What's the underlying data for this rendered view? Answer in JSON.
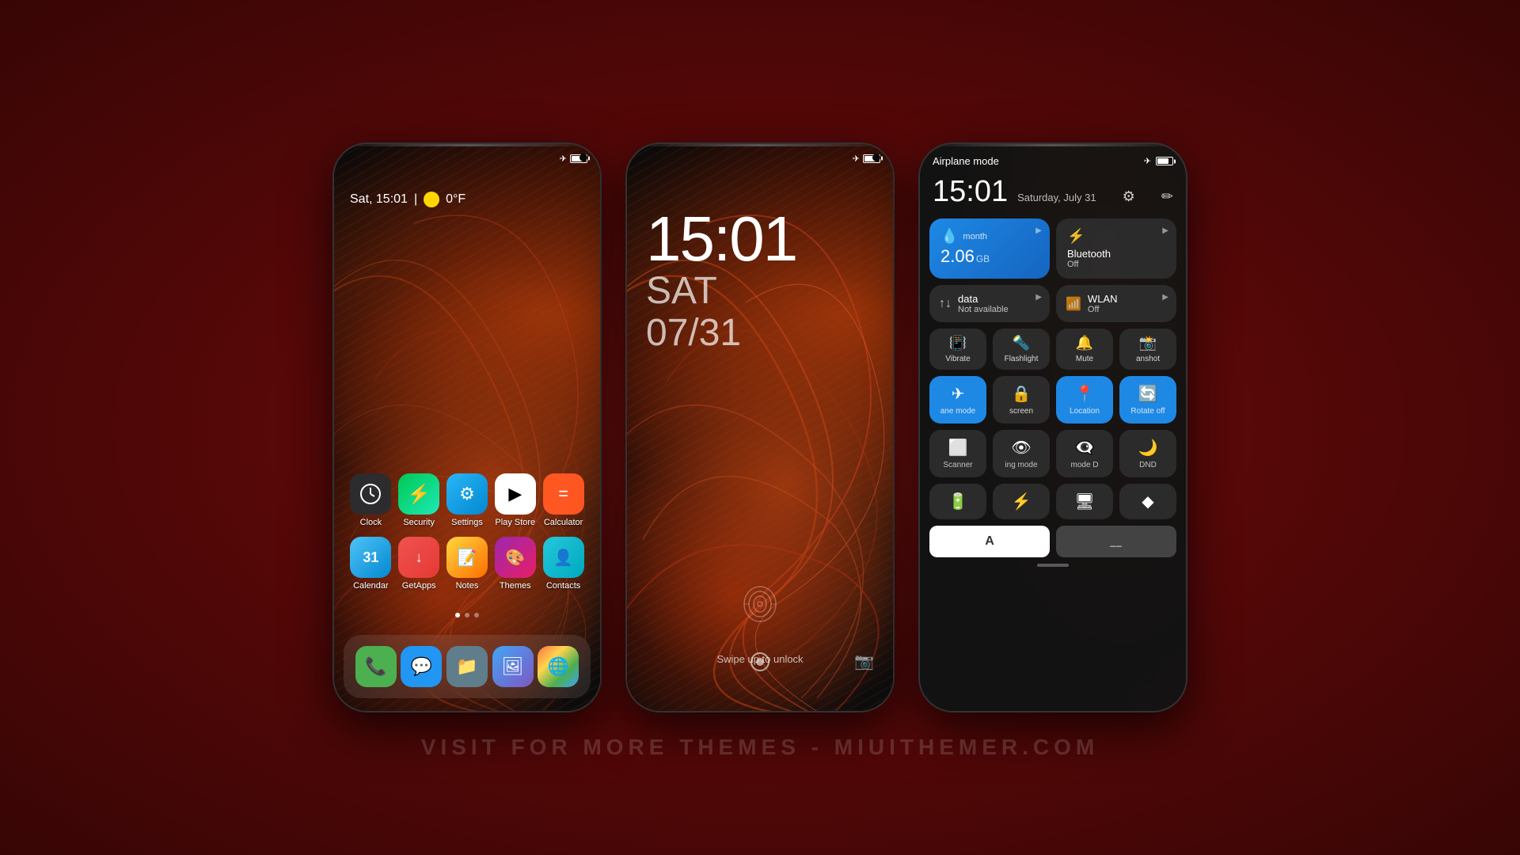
{
  "watermark": "VISIT FOR MORE THEMES - MIUITHEMER.COM",
  "phone1": {
    "status": {
      "battery": "75%",
      "signal_icon": "✈",
      "battery_icon": "🔋"
    },
    "datetime": "Sat, 15:01",
    "temperature": "0°F",
    "apps_row1": [
      {
        "label": "Clock",
        "icon": "clock"
      },
      {
        "label": "Security",
        "icon": "security"
      },
      {
        "label": "Settings",
        "icon": "settings"
      },
      {
        "label": "Play Store",
        "icon": "playstore"
      },
      {
        "label": "Calculator",
        "icon": "calculator"
      }
    ],
    "apps_row2": [
      {
        "label": "Calendar",
        "icon": "calendar"
      },
      {
        "label": "GetApps",
        "icon": "getapps"
      },
      {
        "label": "Notes",
        "icon": "notes"
      },
      {
        "label": "Themes",
        "icon": "themes"
      },
      {
        "label": "Contacts",
        "icon": "contacts"
      }
    ],
    "dock": [
      {
        "label": "Phone",
        "icon": "phone"
      },
      {
        "label": "Messages",
        "icon": "messages"
      },
      {
        "label": "Files",
        "icon": "files"
      },
      {
        "label": "Gallery",
        "icon": "gallery"
      },
      {
        "label": "Browser",
        "icon": "browser"
      }
    ]
  },
  "phone2": {
    "time": "15:01",
    "day": "SAT",
    "date": "07/31",
    "swipe_text": "Swipe up to unlock"
  },
  "phone3": {
    "airplane_mode": "Airplane mode",
    "time": "15:01",
    "date": "Saturday, July 31",
    "big_tiles": [
      {
        "icon": "💧",
        "label": "month",
        "amount": "2.06",
        "unit": "GB",
        "active": true
      },
      {
        "icon": "bluetooth",
        "label": "Bluetooth",
        "sub": "Off",
        "active": false
      }
    ],
    "row2_tiles": [
      {
        "icon": "data",
        "label": "data",
        "sub": "Not available"
      },
      {
        "icon": "wifi",
        "label": "WLAN",
        "sub": "Off"
      }
    ],
    "small_tiles": [
      {
        "icon": "vibrate",
        "label": "Vibrate",
        "active": false
      },
      {
        "icon": "flashlight",
        "label": "Flashlight",
        "active": false
      },
      {
        "icon": "mute",
        "label": "Mute",
        "active": false
      },
      {
        "icon": "screenshot",
        "label": "anshot",
        "active": false
      }
    ],
    "medium_tiles": [
      {
        "icon": "airplane",
        "label": "ane mode",
        "active": true
      },
      {
        "icon": "lock-screen",
        "label": "screen",
        "active": false
      },
      {
        "icon": "location",
        "label": "Location",
        "active": true
      },
      {
        "icon": "rotate-off",
        "label": "Rotate off",
        "active": true
      }
    ],
    "bottom_tiles_row1": [
      {
        "icon": "scanner",
        "label": "Scanner"
      },
      {
        "icon": "reading",
        "label": "ing mode"
      },
      {
        "icon": "mode",
        "label": "mode D"
      },
      {
        "icon": "dnd",
        "label": "DND"
      }
    ],
    "bottom_tiles_row2": [
      {
        "icon": "battery-saver"
      },
      {
        "icon": "lightning"
      },
      {
        "icon": "screen2"
      },
      {
        "icon": "code"
      }
    ]
  }
}
